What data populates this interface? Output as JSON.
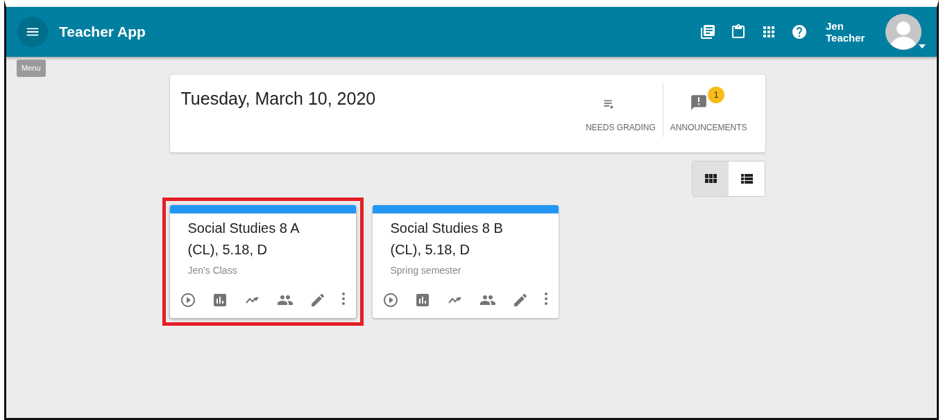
{
  "app_bar": {
    "title": "Teacher App",
    "menu_tooltip": "Menu",
    "user_name": "Jen Teacher"
  },
  "summary": {
    "date": "Tuesday, March 10, 2020",
    "actions": [
      {
        "kind": "grading",
        "label": "NEEDS GRADING"
      },
      {
        "kind": "announcements",
        "label": "ANNOUNCEMENTS",
        "badge": "1"
      }
    ]
  },
  "view_toggle": [
    {
      "kind": "grid",
      "selected": true
    },
    {
      "kind": "list",
      "selected": false
    }
  ],
  "classes": [
    {
      "title": "Social Studies 8 A (CL), 5.18, D",
      "subtitle": "Jen's Class",
      "highlighted": true
    },
    {
      "title": "Social Studies 8 B (CL), 5.18, D",
      "subtitle": "Spring semester",
      "highlighted": false
    }
  ]
}
